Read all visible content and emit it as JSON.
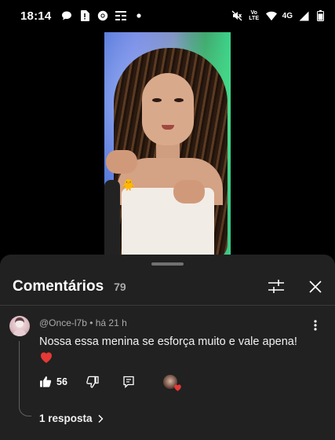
{
  "status_bar": {
    "time": "18:14",
    "volte_line1": "Vo",
    "volte_line2": "LTE",
    "network": "4G",
    "left_icons": [
      "chat-icon",
      "sim-alert-icon",
      "chrome-icon",
      "news-icon",
      "dot-icon"
    ],
    "right_icons": [
      "mute-icon",
      "wifi-icon",
      "signal-icon",
      "battery-icon"
    ]
  },
  "video": {
    "sticker": "🐥"
  },
  "comments_sheet": {
    "title": "Comentários",
    "count": "79",
    "header_icons": [
      "filter-icon",
      "close-icon"
    ],
    "comments": [
      {
        "author": "@Once-l7b",
        "time": "há 21 h",
        "meta": "@Once-l7b • há 21 h",
        "text": "Nossa essa menina se esforça muito e vale apena!",
        "emoji_line": "heart-emoji",
        "likes": "56",
        "replies_label": "1 resposta"
      }
    ]
  },
  "colors": {
    "sheet_bg": "#212121",
    "meta_text": "#aaaaaa",
    "heart_red": "#e53935"
  }
}
